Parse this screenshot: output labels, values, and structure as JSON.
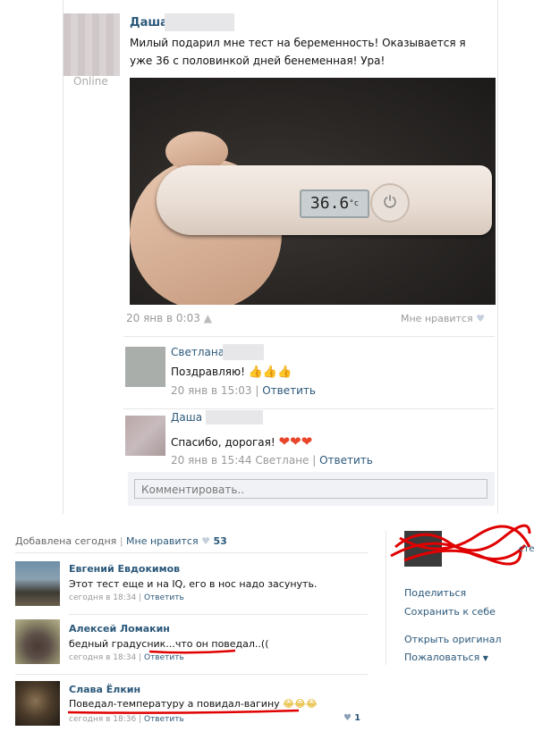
{
  "post": {
    "author": "Даша",
    "status": "Online",
    "text": "Милый подарил мне тест на беременность! Оказывается я уже 36 с половинкой дней бенеменная! Ура!",
    "display": "36.6",
    "unit": "°c",
    "date": "20 янв в 0:03",
    "like_label": "Мне нравится"
  },
  "comments": [
    {
      "author": "Светлана",
      "text": "Поздравляю!",
      "emoji": "thumbs-up-icon",
      "date": "20 янв в 15:03",
      "reply_to": "",
      "reply": "Ответить"
    },
    {
      "author": "Даша",
      "text": "Спасибо, дорогая!",
      "emoji": "heart-icon",
      "date": "20 янв в 15:44",
      "reply_to": "Светлане",
      "reply": "Ответить"
    }
  ],
  "comment_placeholder": "Комментировать..",
  "bottom": {
    "added": "Добавлена сегодня",
    "likes_label": "Мне нравится",
    "likes_count": "53",
    "comments": [
      {
        "author": "Евгений Евдокимов",
        "text": "Этот тест еще и на IQ, его в нос надо засунуть.",
        "time": "сегодня в 18:34",
        "reply": "Ответить"
      },
      {
        "author": "Алексей Ломакин",
        "text": "бедный градусник...что он поведал..((",
        "time": "сегодня в 18:34",
        "reply": "Ответить"
      },
      {
        "author": "Слава Ёлкин",
        "text": "Поведал-температуру а повидал-вагину",
        "time": "сегодня в 18:36",
        "reply": "Ответить",
        "likes": "1"
      }
    ],
    "side": {
      "fragment": "сте",
      "share": "Поделиться",
      "save": "Сохранить к себе",
      "open_original": "Открыть оригинал",
      "report": "Пожаловаться"
    }
  },
  "colors": {
    "link": "#2b587a",
    "meta": "#999999",
    "underline": "#e00000",
    "heart": "#e8452a"
  }
}
